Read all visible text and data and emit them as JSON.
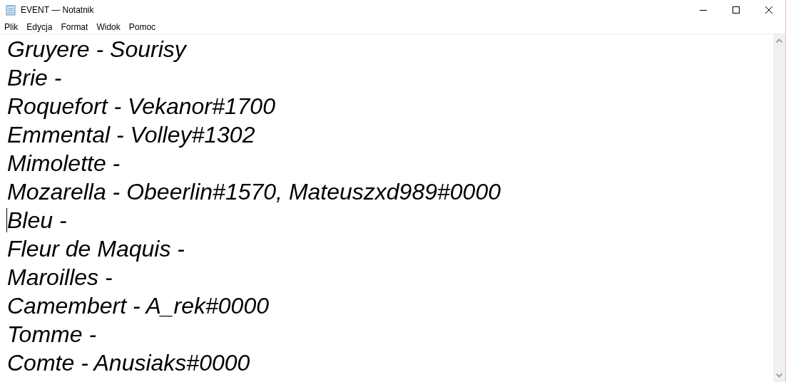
{
  "window": {
    "title": "EVENT — Notatnik"
  },
  "menu": [
    "Plik",
    "Edycja",
    "Format",
    "Widok",
    "Pomoc"
  ],
  "lines": [
    {
      "text": "Gruyere - Sourisy",
      "caret": false
    },
    {
      "text": "Brie -",
      "caret": false
    },
    {
      "text": "Roquefort - Vekanor#1700",
      "caret": false
    },
    {
      "text": "Emmental - Volley#1302",
      "caret": false
    },
    {
      "text": "Mimolette -",
      "caret": false
    },
    {
      "text": "Mozarella - Obeerlin#1570, Mateuszxd989#0000",
      "caret": false
    },
    {
      "text": "Bleu -",
      "caret": true
    },
    {
      "text": "Fleur de Maquis -",
      "caret": false
    },
    {
      "text": "Maroilles -",
      "caret": false
    },
    {
      "text": "Camembert - A_rek#0000",
      "caret": false
    },
    {
      "text": "Tomme -",
      "caret": false
    },
    {
      "text": "Comte - Anusiaks#0000",
      "caret": false
    }
  ]
}
